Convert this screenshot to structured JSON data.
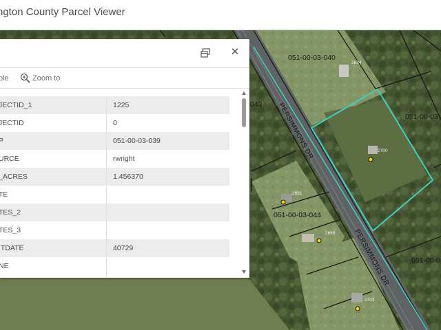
{
  "header": {
    "title": "ngton County Parcel Viewer"
  },
  "popup": {
    "actions": {
      "table_label": "ble",
      "zoom_label": "Zoom to"
    },
    "attributes": [
      {
        "key": "JECTID_1",
        "value": "1225"
      },
      {
        "key": "JECTID",
        "value": "0"
      },
      {
        "key": "P",
        "value": "051-00-03-039"
      },
      {
        "key": "URCE",
        "value": "rwright"
      },
      {
        "key": "_ACRES",
        "value": "1.456370"
      },
      {
        "key": "TE",
        "value": ""
      },
      {
        "key": "TES_2",
        "value": ""
      },
      {
        "key": "TES_3",
        "value": ""
      },
      {
        "key": "ITDATE",
        "value": "40729"
      },
      {
        "key": "NE",
        "value": ""
      }
    ]
  },
  "map": {
    "parcels": [
      {
        "id": "p040",
        "label": "051-00-03-040"
      },
      {
        "id": "p039",
        "label": "051-00-03-03"
      },
      {
        "id": "p044",
        "label": "051-00-03-044"
      },
      {
        "id": "p_right",
        "label": "051-00-0"
      },
      {
        "id": "p_edge",
        "label": "043"
      }
    ],
    "addresses": [
      "2634",
      "2700",
      "2681",
      "2689",
      "2703"
    ],
    "streets": [
      "PERSIMMONS DR",
      "PERSIMMONS DR"
    ],
    "colors": {
      "selection": "#3fd0c0",
      "parcel_line": "#151515",
      "road": "#5f6363"
    }
  }
}
